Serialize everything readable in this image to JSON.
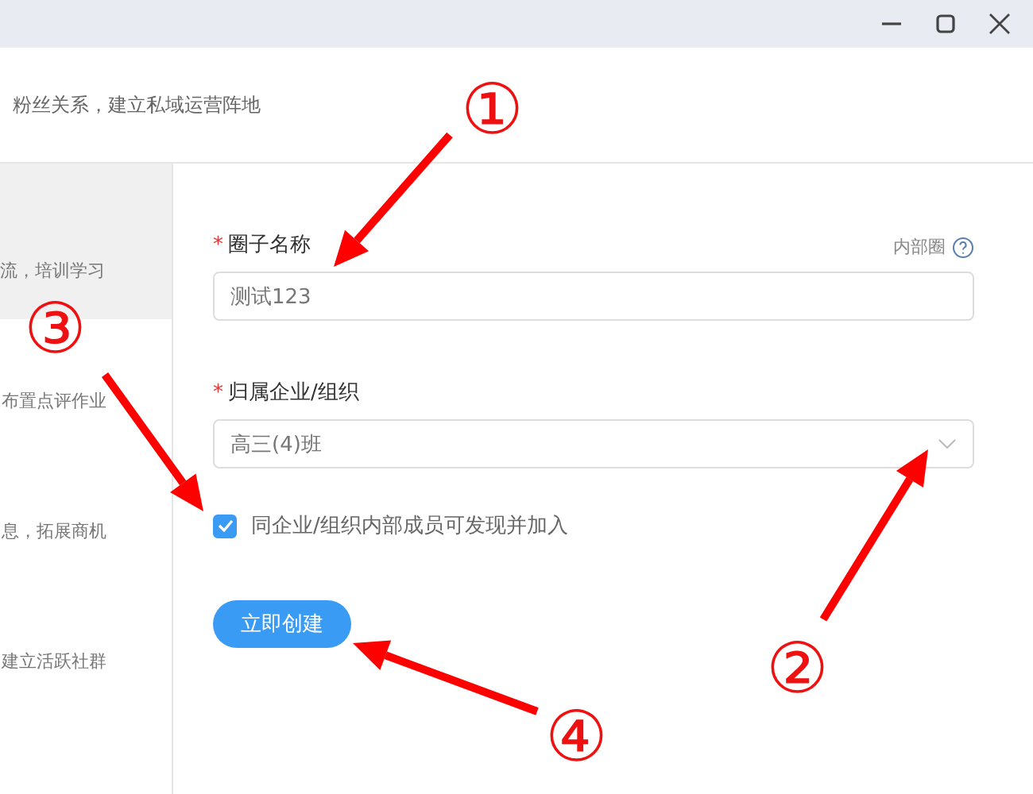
{
  "header": {
    "subtitle": "粉丝关系，建立私域运营阵地"
  },
  "sidebar": {
    "items": [
      {
        "text": "流，培训学习",
        "selected": true
      },
      {
        "text": "布置点评作业",
        "selected": false
      },
      {
        "text": "息，拓展商机",
        "selected": false
      },
      {
        "text": "建立活跃社群",
        "selected": false
      }
    ]
  },
  "form": {
    "fields": [
      {
        "kind": "input",
        "mark": "*",
        "label": "圈子名称",
        "value": "测试123",
        "hint": "内部圈"
      },
      {
        "kind": "select",
        "mark": "*",
        "label": "归属企业/组织",
        "value": "高三(4)班"
      }
    ],
    "checkbox": {
      "label": "同企业/组织内部成员可发现并加入",
      "checked": true
    },
    "submit": "立即创建"
  },
  "annotations": [
    {
      "label": "①"
    },
    {
      "label": "②"
    },
    {
      "label": "③"
    },
    {
      "label": "④"
    }
  ]
}
